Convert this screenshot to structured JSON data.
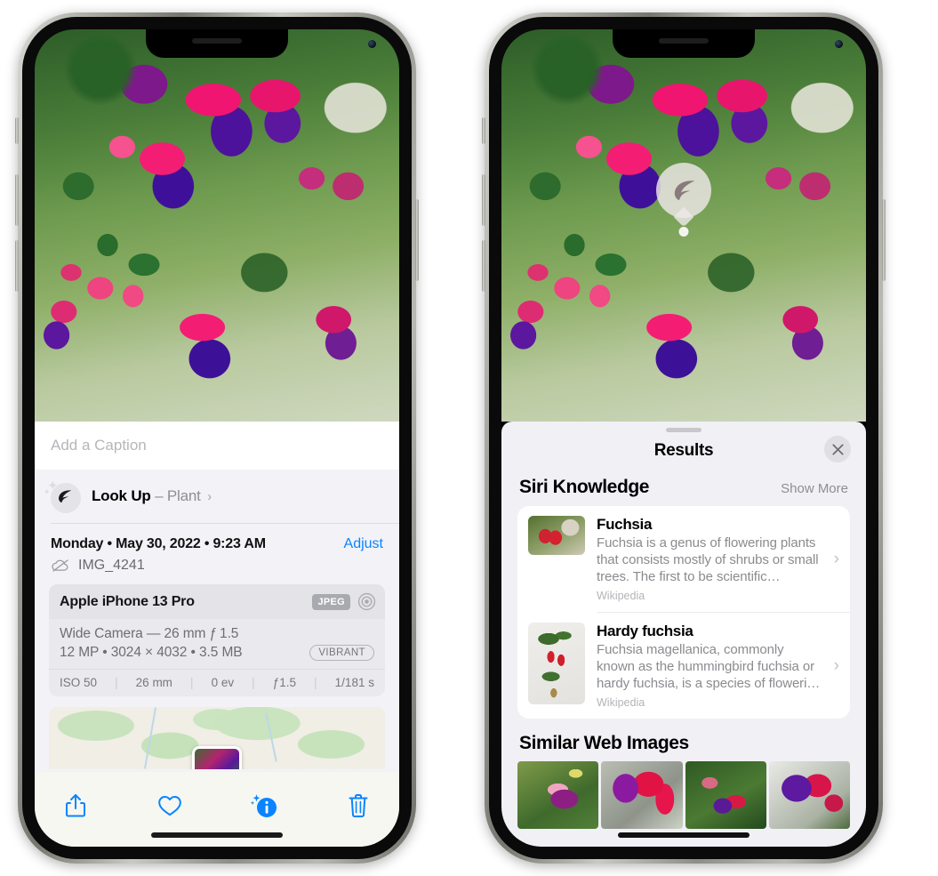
{
  "left_phone": {
    "photo_alt": "fuchsia-flowers-photo",
    "caption": {
      "placeholder": "Add a Caption",
      "value": ""
    },
    "look_up": {
      "title": "Look Up",
      "dash": "–",
      "subject": "Plant",
      "chevron": "›",
      "icon": "leaf-icon"
    },
    "date_row": {
      "date": "Monday • May 30, 2022 • 9:23 AM",
      "adjust_label": "Adjust"
    },
    "file_row": {
      "icon": "cloud-slash-icon",
      "filename": "IMG_4241"
    },
    "camera_card": {
      "device": "Apple iPhone 13 Pro",
      "format_badge": "JPEG",
      "hdr_icon": "aperture-icon",
      "lens_line": "Wide Camera — 26 mm ƒ 1.5",
      "size_line": "12 MP • 3024 × 4032 • 3.5 MB",
      "vibrant_badge": "VIBRANT",
      "exif": [
        "ISO 50",
        "26 mm",
        "0 ev",
        "ƒ1.5",
        "1/181 s"
      ],
      "exif_separator": "|"
    },
    "map": {
      "name": "photo-location-map"
    },
    "toolbar": [
      {
        "name": "share-button",
        "icon": "share-icon"
      },
      {
        "name": "favorite-button",
        "icon": "heart-icon"
      },
      {
        "name": "info-button",
        "icon": "info-sparkle-icon"
      },
      {
        "name": "delete-button",
        "icon": "trash-icon"
      }
    ]
  },
  "right_phone": {
    "visual_lookup_marker": {
      "icon": "leaf-icon",
      "name": "visual-lookup-marker"
    },
    "sheet": {
      "title": "Results",
      "close_icon": "close-icon",
      "sections": [
        {
          "title": "Siri Knowledge",
          "action": "Show More",
          "items": [
            {
              "name": "Fuchsia",
              "description": "Fuchsia is a genus of flowering plants that consists mostly of shrubs or small trees. The first to be scientific…",
              "source": "Wikipedia",
              "chevron": "›"
            },
            {
              "name": "Hardy fuchsia",
              "description": "Fuchsia magellanica, commonly known as the hummingbird fuchsia or hardy fuchsia, is a species of floweri…",
              "source": "Wikipedia",
              "chevron": "›"
            }
          ]
        },
        {
          "title": "Similar Web Images",
          "items": [
            {
              "name": "similar-image-1"
            },
            {
              "name": "similar-image-2"
            },
            {
              "name": "similar-image-3"
            },
            {
              "name": "similar-image-4"
            }
          ]
        }
      ]
    }
  },
  "colors": {
    "accent_blue": "#0a84ff",
    "sheet_bg": "#f2f2f7",
    "results_bg": "#f1f0f5",
    "card_bg": "#ffffff",
    "secondary_text": "#8e8e93"
  }
}
